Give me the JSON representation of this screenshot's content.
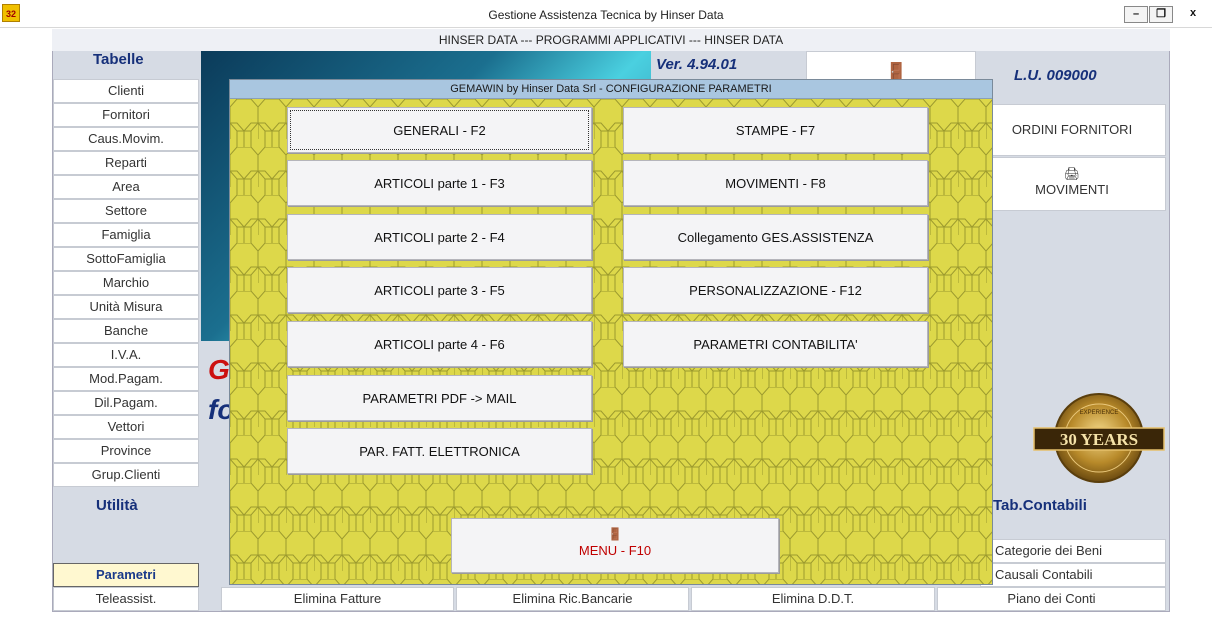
{
  "window": {
    "icon_text": "32",
    "title": "Gestione Assistenza Tecnica by Hinser Data",
    "minimize": "–",
    "restore": "❐",
    "close": "x"
  },
  "app": {
    "subtitle": "HINSER DATA --- PROGRAMMI APPLICATIVI --- HINSER DATA",
    "version": "Ver. 4.94.01",
    "lu": "L.U. 009000",
    "exit_icon": "🚪",
    "big_letter_1": "G",
    "big_letter_2": "fo",
    "badge_text": "30 YEARS",
    "badge_sub": "EXPERIENCE"
  },
  "left": {
    "tabelle_title": "Tabelle",
    "items": [
      "Clienti",
      "Fornitori",
      "Caus.Movim.",
      "Reparti",
      "Area",
      "Settore",
      "Famiglia",
      "SottoFamiglia",
      "Marchio",
      "Unità Misura",
      "Banche",
      "I.V.A.",
      "Mod.Pagam.",
      "Dil.Pagam.",
      "Vettori",
      "Province",
      "Grup.Clienti"
    ],
    "utilita_title": "Utilità",
    "parametri": "Parametri",
    "teleassist": "Teleassist."
  },
  "right": {
    "ordini": "ORDINI FORNITORI",
    "movimenti_icon": "🖨",
    "movimenti": "MOVIMENTI",
    "tab_contabili_title": "Tab.Contabili",
    "categorie": "Categorie dei Beni",
    "causali": "Causali Contabili",
    "piano": "Piano dei Conti"
  },
  "bottom": {
    "elimina_fatture": "Elimina Fatture",
    "elimina_ric": "Elimina Ric.Bancarie",
    "elimina_ddt": "Elimina D.D.T."
  },
  "dialog": {
    "title": "GEMAWIN by Hinser Data Srl - CONFIGURAZIONE PARAMETRI",
    "left_buttons": [
      "GENERALI - F2",
      "ARTICOLI parte 1 - F3",
      "ARTICOLI parte 2 - F4",
      "ARTICOLI parte 3 - F5",
      "ARTICOLI parte 4 - F6",
      "PARAMETRI PDF -> MAIL",
      "PAR. FATT. ELETTRONICA"
    ],
    "right_buttons": [
      "STAMPE - F7",
      "MOVIMENTI - F8",
      "Collegamento GES.ASSISTENZA",
      "PERSONALIZZAZIONE - F12",
      "PARAMETRI CONTABILITA'"
    ],
    "menu_icon": "🚪",
    "menu_label": "MENU - F10"
  },
  "colors": {
    "dialog_bg": "#ddd84a",
    "hex_line": "#9c9a2e",
    "title_bar": "#a9c6e0",
    "accent_blue": "#16307a",
    "accent_red": "#cc1010"
  }
}
